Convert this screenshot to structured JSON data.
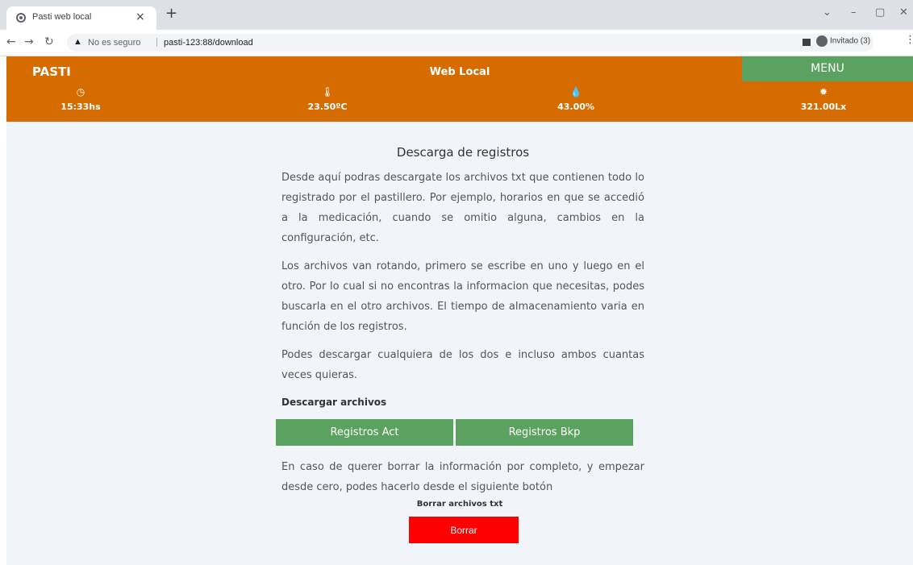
{
  "browser": {
    "tab_title": "Pasti web local",
    "tab_close": "×",
    "new_tab": "+",
    "security_label": "No es seguro",
    "url": "pasti-123:88/download",
    "profile_label": "Invitado (3)"
  },
  "header": {
    "brand": "PASTI",
    "title": "Web Local",
    "menu_label": "MENU",
    "stats": [
      {
        "icon": "clock-icon",
        "value": "15:33hs"
      },
      {
        "icon": "thermometer-icon",
        "value": "23.50ºC"
      },
      {
        "icon": "droplet-icon",
        "value": "43.00%"
      },
      {
        "icon": "sun-icon",
        "value": "321.00Lx"
      }
    ]
  },
  "main": {
    "heading": "Descarga de registros",
    "paragraph1": "Desde aquí podras descargate los archivos txt que contienen todo lo registrado por el pastillero. Por ejemplo, horarios en que se accedió a la medicación, cuando se omitio alguna, cambios en la configuración, etc.",
    "paragraph2": "Los archivos van rotando, primero se escribe en uno y luego en el otro. Por lo cual si no encontras la informacion que necesitas, podes buscarla en el otro archivos. El tiempo de almacenamiento varia en función de los registros.",
    "paragraph3": "Podes descargar cualquiera de los dos e incluso ambos cuantas veces quieras.",
    "download_heading": "Descargar archivos",
    "btn_act": "Registros Act",
    "btn_bkp": "Registros Bkp",
    "paragraph4": "En caso de querer borrar la información por completo, y empezar desde cero, podes hacerlo desde el siguiente botón",
    "delete_label": "Borrar archivos txt",
    "delete_button": "Borrar"
  },
  "colors": {
    "header": "#d66b00",
    "green": "#5ba15f",
    "danger": "#ff0000",
    "page_bg": "#f1f4f8"
  }
}
